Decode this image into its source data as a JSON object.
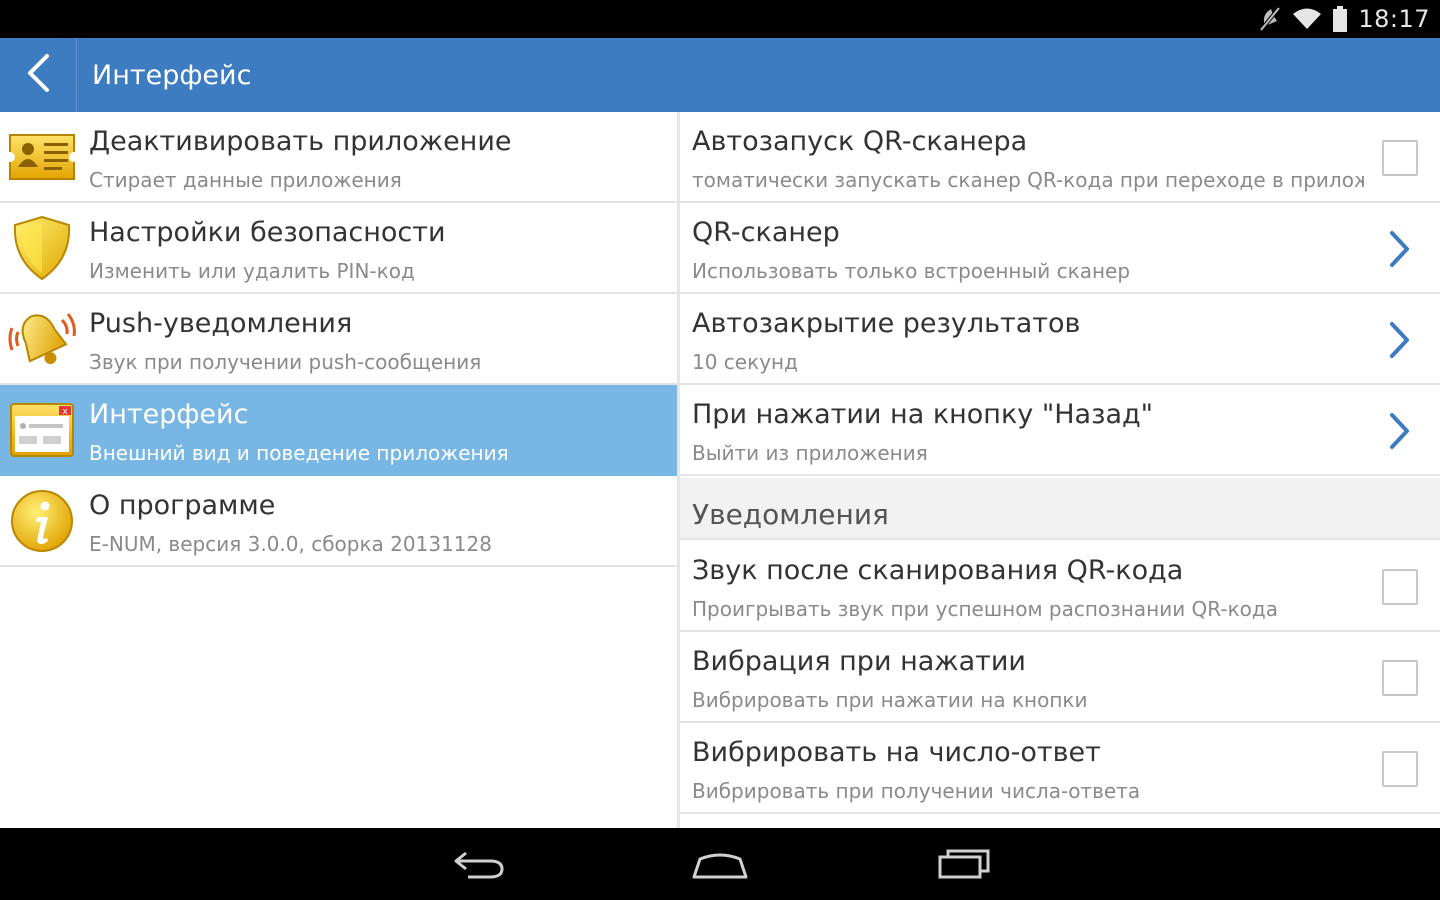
{
  "status_bar": {
    "time": "18:17",
    "icons": [
      "mute-icon",
      "wifi-icon",
      "battery-icon"
    ]
  },
  "action_bar": {
    "title": "Интерфейс",
    "back_icon": "back-arrow-icon",
    "background_color": "#3e7cc1"
  },
  "sidebar": {
    "items": [
      {
        "title": "Деактивировать приложение",
        "subtitle": "Стирает данные приложения",
        "icon": "id-card-icon",
        "active": false
      },
      {
        "title": "Настройки безопасности",
        "subtitle": "Изменить или удалить PIN-код",
        "icon": "shield-icon",
        "active": false
      },
      {
        "title": "Push-уведомления",
        "subtitle": "Звук при получении push-сообщения",
        "icon": "bell-icon",
        "active": false
      },
      {
        "title": "Интерфейс",
        "subtitle": "Внешний вид и поведение приложения",
        "icon": "window-icon",
        "active": true
      },
      {
        "title": "О программе",
        "subtitle": "E-NUM, версия 3.0.0, сборка 20131128",
        "icon": "info-icon",
        "active": false
      }
    ],
    "active_color": "#78b6e4"
  },
  "settings": {
    "items": [
      {
        "title": "Автозапуск QR-сканера",
        "subtitle": "томатически запускать сканер QR-кода при переходе в приложе",
        "control": "checkbox",
        "checked": false
      },
      {
        "title": "QR-сканер",
        "subtitle": "Использовать только встроенный сканер",
        "control": "chevron"
      },
      {
        "title": "Автозакрытие результатов",
        "subtitle": "10 секунд",
        "control": "chevron"
      },
      {
        "title": "При нажатии на кнопку \"Назад\"",
        "subtitle": "Выйти из приложения",
        "control": "chevron"
      }
    ],
    "section_header": "Уведомления",
    "notification_items": [
      {
        "title": "Звук после сканирования QR-кода",
        "subtitle": "Проигрывать звук при успешном распознании QR-кода",
        "control": "checkbox",
        "checked": false
      },
      {
        "title": "Вибрация при нажатии",
        "subtitle": "Вибрировать при нажатии на кнопки",
        "control": "checkbox",
        "checked": false
      },
      {
        "title": "Вибрировать на число-ответ",
        "subtitle": "Вибрировать при получении числа-ответа",
        "control": "checkbox",
        "checked": false
      }
    ],
    "chevron_color": "#3e7cc1"
  },
  "navigation_bar": {
    "buttons": [
      "back-nav-icon",
      "home-nav-icon",
      "recents-nav-icon"
    ]
  }
}
